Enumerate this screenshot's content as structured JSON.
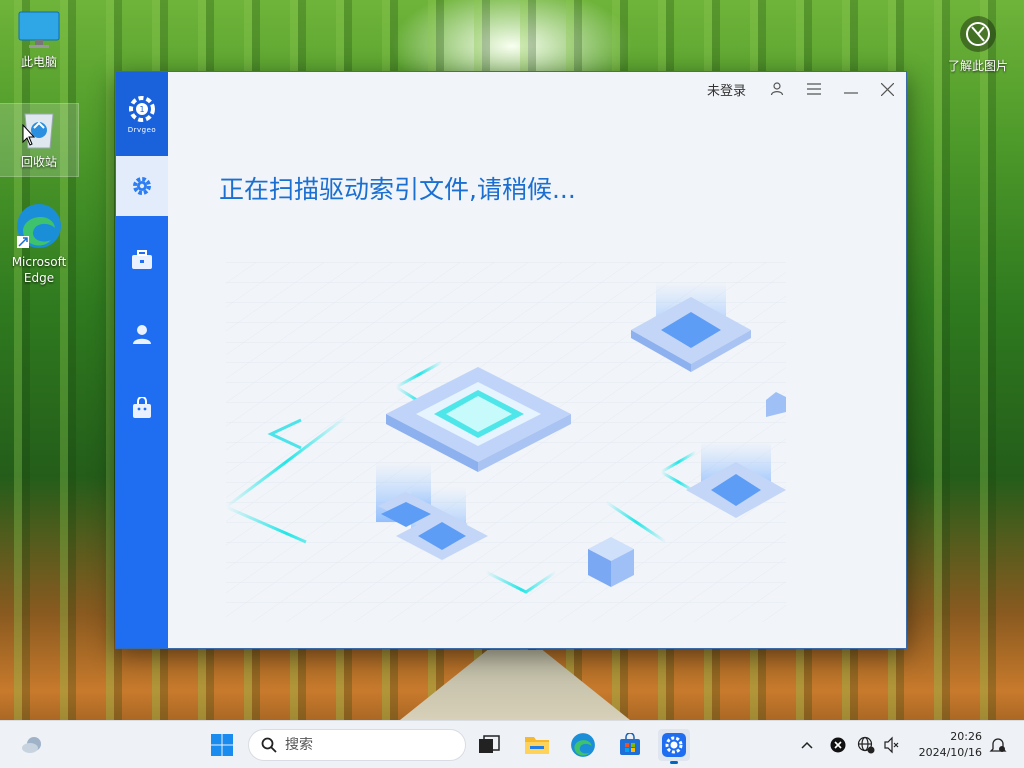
{
  "desktop": {
    "icons": [
      {
        "label": "此电脑"
      },
      {
        "label": "回收站"
      },
      {
        "label": "Microsoft Edge"
      }
    ],
    "learn_picture": "了解此图片"
  },
  "app": {
    "logo_text": "Drvgeo",
    "login_status": "未登录",
    "scan_message": "正在扫描驱动索引文件,请稍候...",
    "nav": [
      "gear-icon",
      "toolbox-icon",
      "user-icon",
      "bag-icon"
    ],
    "accent": "#1f6ef1"
  },
  "taskbar": {
    "search_placeholder": "搜索",
    "time": "20:26",
    "date": "2024/10/16"
  }
}
